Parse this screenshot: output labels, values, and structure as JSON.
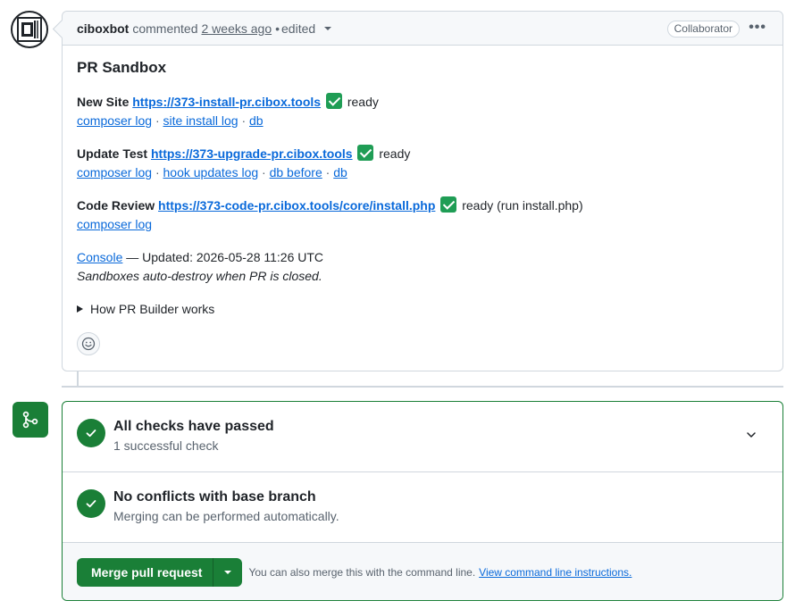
{
  "comment": {
    "author": "ciboxbot",
    "action": "commented",
    "time": "2 weeks ago",
    "separator": "•",
    "edited_label": "edited",
    "badge": "Collaborator",
    "more": "•••",
    "title": "PR Sandbox",
    "new_site": {
      "label": "New Site",
      "url": "https://373-install-pr.cibox.tools",
      "status": "ready",
      "links": [
        "composer log",
        "site install log",
        "db"
      ]
    },
    "update_test": {
      "label": "Update Test",
      "url": "https://373-upgrade-pr.cibox.tools",
      "status": "ready",
      "links": [
        "composer log",
        "hook updates log",
        "db before",
        "db"
      ]
    },
    "code_review": {
      "label": "Code Review",
      "url": "https://373-code-pr.cibox.tools/core/install.php",
      "status": "ready (run install.php)",
      "links": [
        "composer log"
      ]
    },
    "console_link": "Console",
    "updated_text": "— Updated: 2026-05-28 11:26 UTC",
    "auto_destroy": "Sandboxes auto-destroy when PR is closed.",
    "details_summary": "How PR Builder works",
    "link_sep": "·"
  },
  "merge": {
    "checks_title": "All checks have passed",
    "checks_sub": "1 successful check",
    "conflicts_title": "No conflicts with base branch",
    "conflicts_sub": "Merging can be performed automatically.",
    "button_label": "Merge pull request",
    "hint_text": "You can also merge this with the command line.",
    "hint_link": "View command line instructions."
  },
  "colors": {
    "success": "#1a7f37",
    "link": "#0969da",
    "border": "#d0d7de"
  }
}
